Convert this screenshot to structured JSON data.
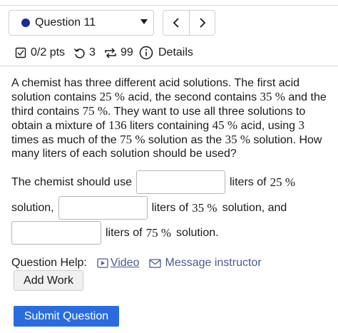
{
  "header": {
    "question_label": "Question 11",
    "prev_glyph": "<",
    "next_glyph": ">"
  },
  "meta": {
    "points": "0/2 pts",
    "retries": "3",
    "attempts": "99",
    "details": "Details"
  },
  "question": {
    "s1": "A chemist has three different acid solutions. The first acid solution contains ",
    "p1": "25 %",
    "s2": " acid, the second contains ",
    "p2": "35 %",
    "s3": " and the third contains ",
    "p3": "75 %",
    "s4": ". They want to use all three solutions to obtain a mixture of ",
    "liters": "136",
    "s5": " liters containing ",
    "p4": "45 %",
    "s6": " acid, using ",
    "times": "3",
    "s7": " times as much of the ",
    "p5": "75 %",
    "s8": " solution as the ",
    "p6": "35 %",
    "s9": " solution. How many liters of each solution should be used?"
  },
  "answer": {
    "lead": "The chemist should use",
    "after1": "liters of",
    "pct1": "25 %",
    "line2_start": "solution,",
    "after2": "liters of",
    "pct2": "35 %",
    "after2b": "solution, and",
    "after3": "liters of",
    "pct3": "75 %",
    "after3b": "solution."
  },
  "help": {
    "label": "Question Help:",
    "video": "Video",
    "message": "Message instructor"
  },
  "buttons": {
    "add_work": "Add Work",
    "submit": "Submit Question"
  },
  "colors": {
    "accent": "#2a6ce0",
    "link": "#4a5c8c",
    "dot": "#1b2d8f"
  }
}
